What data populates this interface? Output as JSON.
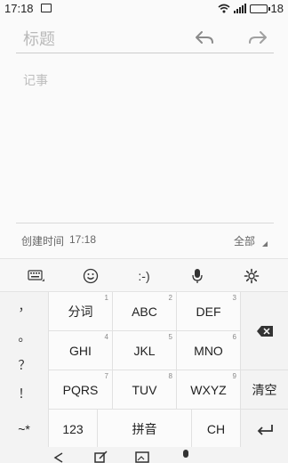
{
  "status": {
    "time": "17:18",
    "battery": "18",
    "icons": [
      "image-icon",
      "wifi-icon",
      "signal-icon",
      "battery-icon"
    ]
  },
  "editor": {
    "title_placeholder": "标题",
    "note_placeholder": "记事",
    "created_label": "创建时间",
    "created_time": "17:18",
    "category": "全部"
  },
  "toolbar": {
    "icons": [
      "keyboard-icon",
      "emoji-icon",
      "emoticon-icon",
      "mic-icon",
      "settings-icon"
    ],
    "emoticon": ":-)"
  },
  "keyboard": {
    "punctuation": [
      "，",
      "。",
      "？",
      "！"
    ],
    "rows": [
      [
        {
          "label": "分词",
          "num": "1"
        },
        {
          "label": "ABC",
          "num": "2"
        },
        {
          "label": "DEF",
          "num": "3"
        }
      ],
      [
        {
          "label": "GHI",
          "num": "4"
        },
        {
          "label": "JKL",
          "num": "5"
        },
        {
          "label": "MNO",
          "num": "6"
        }
      ],
      [
        {
          "label": "PQRS",
          "num": "7"
        },
        {
          "label": "TUV",
          "num": "8"
        },
        {
          "label": "WXYZ",
          "num": "9"
        }
      ]
    ],
    "clear": "清空",
    "bottom": {
      "symbols": "~*",
      "numbers": "123",
      "pinyin": "拼音",
      "lang": "CH"
    }
  },
  "colors": {
    "accent": "#222222",
    "placeholder": "#b9b9b9",
    "bg": "#fafafa"
  }
}
